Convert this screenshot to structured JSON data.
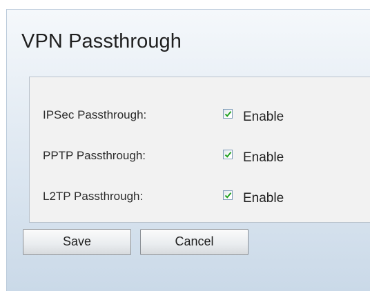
{
  "page": {
    "title": "VPN Passthrough"
  },
  "options": [
    {
      "label": "IPSec Passthrough:",
      "checkbox_label": "Enable",
      "checked": true
    },
    {
      "label": "PPTP Passthrough:",
      "checkbox_label": "Enable",
      "checked": true
    },
    {
      "label": "L2TP Passthrough:",
      "checkbox_label": "Enable",
      "checked": true
    }
  ],
  "buttons": {
    "save_label": "Save",
    "cancel_label": "Cancel"
  },
  "colors": {
    "panel_background": "#dde7f1",
    "options_background": "#f2f2f2",
    "checkmark": "#21a121"
  }
}
